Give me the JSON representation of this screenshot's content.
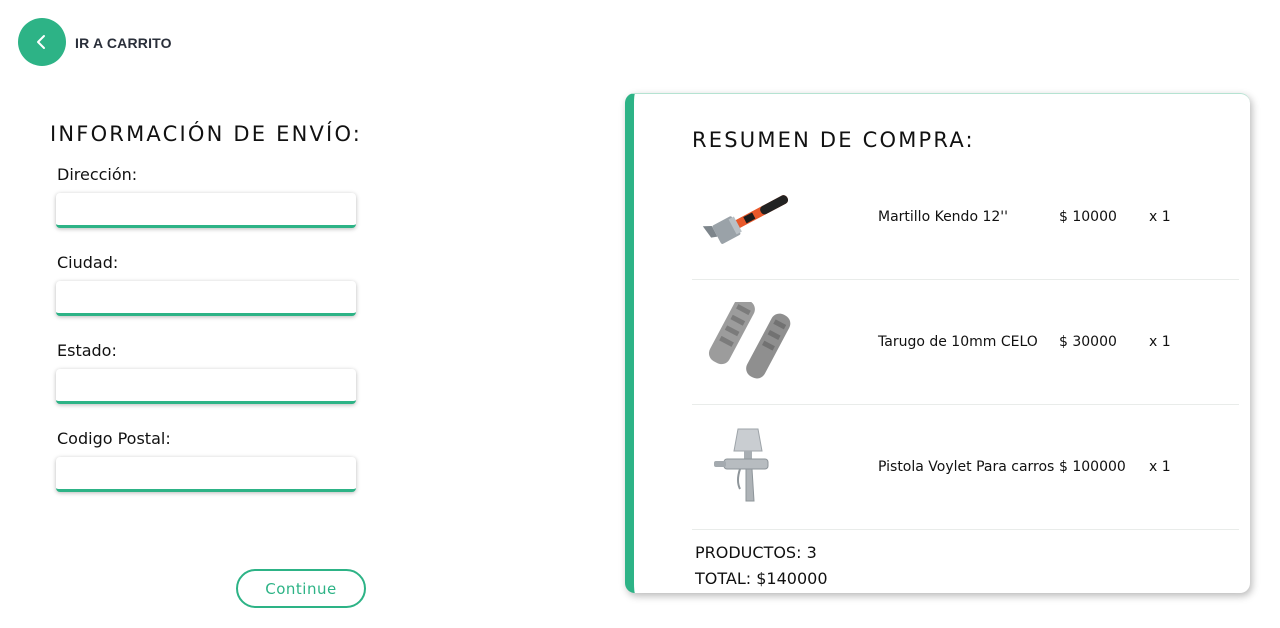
{
  "header": {
    "back_label": "IR A CARRITO"
  },
  "shipping": {
    "title": "INFORMACIÓN DE ENVÍO:",
    "fields": [
      {
        "label": "Dirección:",
        "value": "",
        "placeholder": ""
      },
      {
        "label": "Ciudad:",
        "value": "",
        "placeholder": ""
      },
      {
        "label": "Estado:",
        "value": "",
        "placeholder": ""
      },
      {
        "label": "Codigo Postal:",
        "value": "",
        "placeholder": ""
      }
    ],
    "continue_label": "Continue"
  },
  "summary": {
    "title": "RESUMEN DE COMPRA:",
    "products": [
      {
        "name": "Martillo Kendo 12''",
        "price": "$ 10000",
        "qty": "x 1",
        "icon": "hammer-icon"
      },
      {
        "name": "Tarugo de 10mm CELO",
        "price": "$ 30000",
        "qty": "x 1",
        "icon": "wall-plug-icon"
      },
      {
        "name": "Pistola Voylet Para carros",
        "price": "$ 100000",
        "qty": "x 1",
        "icon": "spray-gun-icon"
      }
    ],
    "count_label": "PRODUCTOS: 3",
    "total_label": "TOTAL: $140000"
  },
  "colors": {
    "accent": "#2db386",
    "text": "#111111"
  }
}
